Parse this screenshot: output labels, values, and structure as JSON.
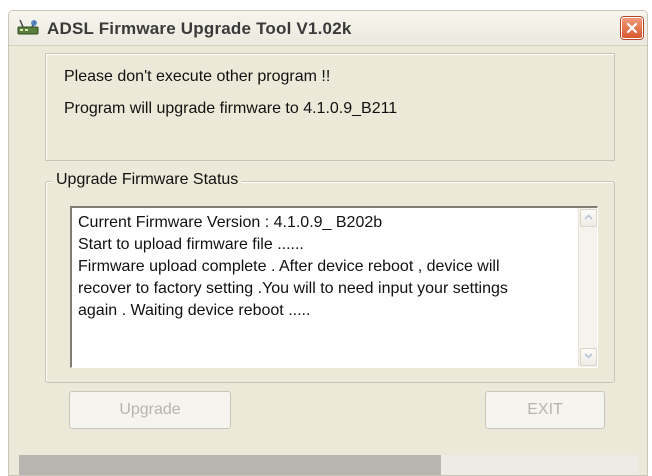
{
  "window": {
    "title": "ADSL Firmware Upgrade Tool V1.02k",
    "icons": {
      "app": "adsl-modem-icon",
      "close": "close-icon"
    }
  },
  "notice": {
    "line1": "Please don't execute other program !!",
    "line2": "Program will upgrade firmware to 4.1.0.9_B211"
  },
  "status_group": {
    "legend": "Upgrade Firmware Status",
    "lines": [
      "Current Firmware Version : 4.1.0.9_  B202b",
      "Start to upload firmware file ......",
      "Firmware upload complete . After device reboot , device will",
      "recover to factory setting .You will to need input your settings",
      "again . Waiting device reboot ....."
    ]
  },
  "buttons": {
    "upgrade_label": "Upgrade",
    "exit_label": "EXIT",
    "upgrade_enabled": false,
    "exit_enabled": false
  },
  "progress": {
    "fraction": 0.68
  },
  "colors": {
    "window_bg": "#ece9d8",
    "close_button": "#d9572f",
    "progress_fill": "#b7b6b1",
    "disabled_text": "#b6b4ac"
  }
}
